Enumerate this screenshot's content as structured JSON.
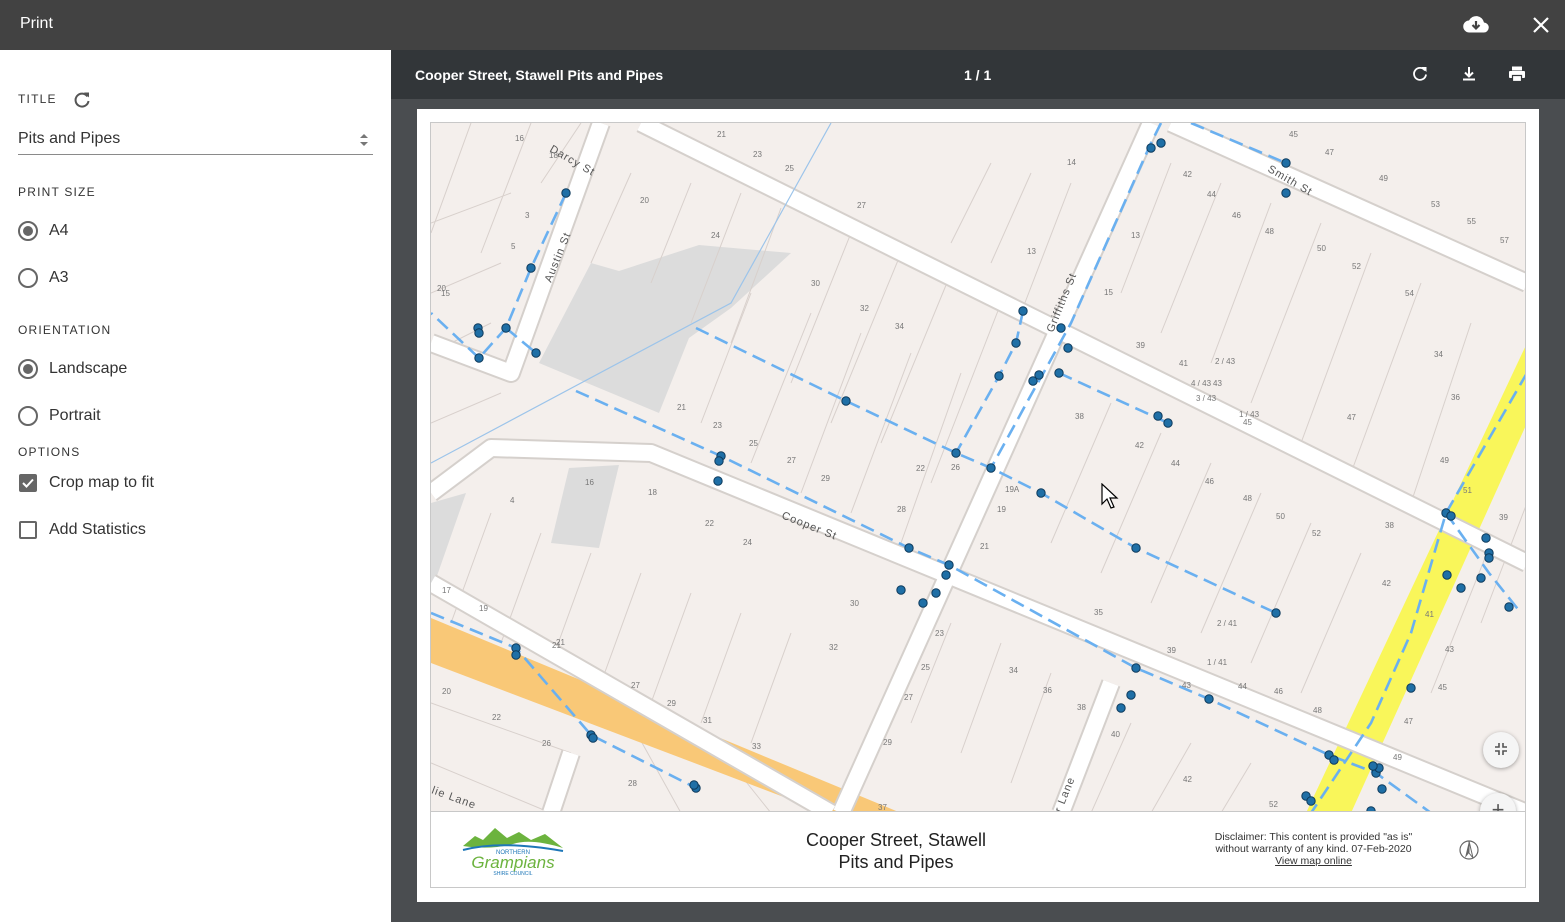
{
  "topbar": {
    "title": "Print"
  },
  "sidebar": {
    "title_section": "TITLE",
    "title_value": "Pits and Pipes",
    "print_size_section": "PRINT SIZE",
    "sizes": [
      {
        "label": "A4",
        "selected": true
      },
      {
        "label": "A3",
        "selected": false
      }
    ],
    "orientation_section": "ORIENTATION",
    "orientations": [
      {
        "label": "Landscape",
        "selected": true
      },
      {
        "label": "Portrait",
        "selected": false
      }
    ],
    "options_section": "OPTIONS",
    "options": [
      {
        "label": "Crop map to fit",
        "checked": true
      },
      {
        "label": "Add Statistics",
        "checked": false
      }
    ]
  },
  "preview": {
    "doc_title": "Cooper Street, Stawell Pits and Pipes",
    "page_indicator": "1 / 1"
  },
  "map": {
    "street_labels": [
      "Darcy St",
      "Smith St",
      "Austin St",
      "Griffiths St",
      "Cooper St",
      "lie Lane",
      "r Lane"
    ],
    "lot_numbers": [
      "16",
      "18",
      "21",
      "23",
      "25",
      "14",
      "45",
      "47",
      "49",
      "53",
      "55",
      "57",
      "20",
      "27",
      "42",
      "44",
      "46",
      "48",
      "50",
      "52",
      "54",
      "3",
      "24",
      "13",
      "20",
      "5",
      "15",
      "30",
      "32",
      "34",
      "13",
      "15",
      "39",
      "41",
      "43",
      "45",
      "4 / 43",
      "3 / 43",
      "2 / 43",
      "1 / 43",
      "34",
      "36",
      "21",
      "23",
      "25",
      "27",
      "29",
      "22",
      "26",
      "28",
      "38",
      "42",
      "44",
      "46",
      "48",
      "50",
      "52",
      "38",
      "47",
      "49",
      "51",
      "39",
      "16",
      "18",
      "4",
      "22",
      "24",
      "19A",
      "19",
      "21",
      "30",
      "32",
      "21",
      "17",
      "19",
      "35",
      "2 / 41",
      "1 / 41",
      "39",
      "43",
      "44",
      "46",
      "48",
      "42",
      "41",
      "43",
      "45",
      "47",
      "49",
      "23",
      "25",
      "27",
      "34",
      "36",
      "38",
      "40",
      "42",
      "20",
      "22",
      "21",
      "27",
      "29",
      "31",
      "33",
      "26",
      "28",
      "29",
      "37",
      "52"
    ]
  },
  "legend": {
    "map_title_line1": "Cooper Street, Stawell",
    "map_title_line2": "Pits and Pipes",
    "disclaimer_line1": "Disclaimer: This content is provided \"as is\"",
    "disclaimer_line2": "without warranty of any kind. 07-Feb-2020",
    "view_online": "View map online",
    "logo_text_top": "NORTHERN",
    "logo_text_main": "Grampians",
    "logo_text_bottom": "SHIRE COUNCIL"
  },
  "colors": {
    "topbar": "#424242",
    "preview_bar": "#323639",
    "preview_bg": "#4a4d50",
    "map_bg": "#f4efec",
    "road": "#ffffff",
    "pipe": "#6ab0f0",
    "pit": "#1f6fa6",
    "major_road": "#f9c877",
    "highway": "#f9f65a",
    "logo_green": "#6cb33e",
    "logo_blue": "#1e77b8"
  },
  "icons": [
    "download-cloud-icon",
    "close-icon",
    "refresh-icon",
    "rotate-icon",
    "download-icon",
    "print-icon",
    "fullscreen-exit-icon",
    "zoom-in-icon",
    "zoom-out-icon",
    "north-arrow-icon"
  ]
}
